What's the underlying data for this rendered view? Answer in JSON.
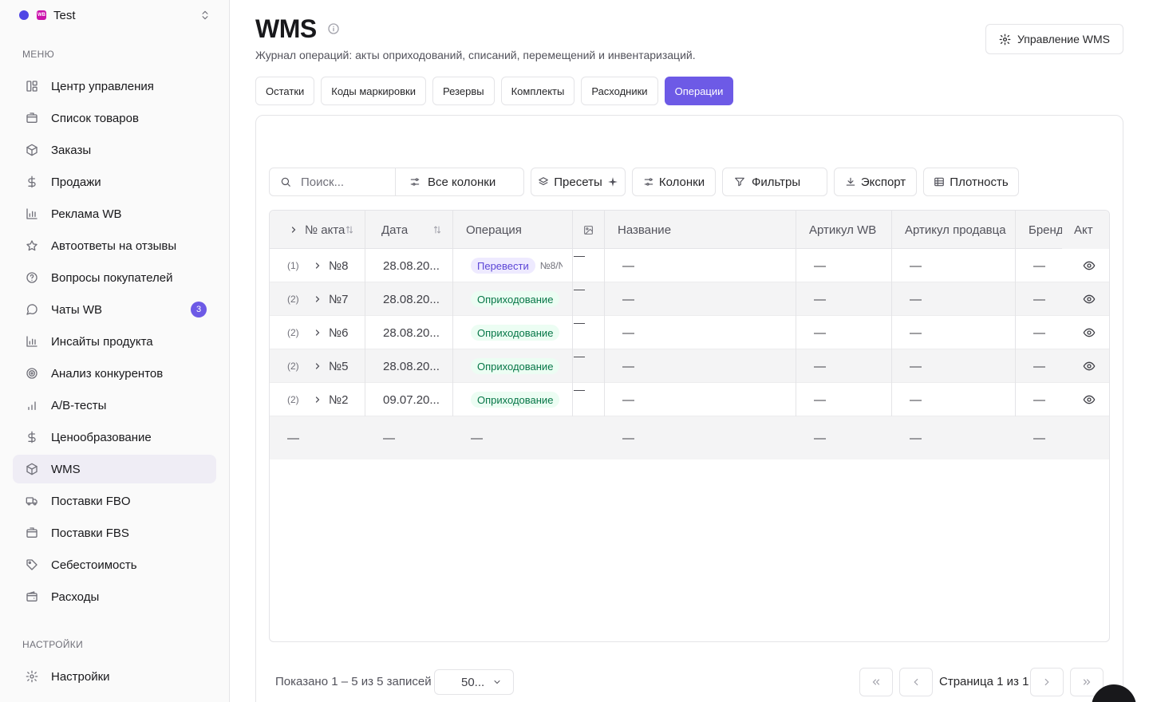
{
  "workspace": {
    "name": "Test",
    "logo_text": "WB"
  },
  "sidebar": {
    "menu_label": "МЕНЮ",
    "settings_label": "НАСТРОЙКИ",
    "items": [
      {
        "label": "Центр управления",
        "icon": "dashboard-icon"
      },
      {
        "label": "Список товаров",
        "icon": "box-icon"
      },
      {
        "label": "Заказы",
        "icon": "package-icon"
      },
      {
        "label": "Продажи",
        "icon": "dollar-icon"
      },
      {
        "label": "Реклама WB",
        "icon": "bar-chart-icon"
      },
      {
        "label": "Автоответы на отзывы",
        "icon": "star-icon"
      },
      {
        "label": "Вопросы покупателей",
        "icon": "help-circle-icon"
      },
      {
        "label": "Чаты WB",
        "icon": "chat-icon",
        "badge": "3"
      },
      {
        "label": "Инсайты продукта",
        "icon": "bar-chart-icon"
      },
      {
        "label": "Анализ конкурентов",
        "icon": "target-icon"
      },
      {
        "label": "A/B-тесты",
        "icon": "signal-icon"
      },
      {
        "label": "Ценообразование",
        "icon": "dollar-icon"
      },
      {
        "label": "WMS",
        "icon": "package-icon",
        "active": true
      },
      {
        "label": "Поставки FBO",
        "icon": "truck-icon"
      },
      {
        "label": "Поставки FBS",
        "icon": "box-icon"
      },
      {
        "label": "Себестоимость",
        "icon": "tag-icon"
      },
      {
        "label": "Расходы",
        "icon": "wallet-icon"
      }
    ],
    "settings_item": {
      "label": "Настройки",
      "icon": "gear-icon"
    }
  },
  "header": {
    "title": "WMS",
    "subtitle": "Журнал операций: акты оприходований, списаний, перемещений и инвентаризаций.",
    "manage_button": "Управление WMS"
  },
  "tabs": [
    {
      "label": "Остатки"
    },
    {
      "label": "Коды маркировки"
    },
    {
      "label": "Резервы"
    },
    {
      "label": "Комплекты"
    },
    {
      "label": "Расходники"
    },
    {
      "label": "Операции",
      "active": true
    }
  ],
  "toolbar": {
    "search_placeholder": "Поиск...",
    "all_columns": "Все колонки",
    "presets": "Пресеты",
    "columns": "Колонки",
    "filters": "Фильтры",
    "export": "Экспорт",
    "density": "Плотность"
  },
  "table": {
    "columns": {
      "act": "№ акта",
      "date": "Дата",
      "operation": "Операция",
      "name": "Название",
      "article_wb": "Артикул WB",
      "article_seller": "Артикул продавца",
      "brand": "Бренд",
      "akt": "Акт"
    },
    "rows": [
      {
        "count": "(1)",
        "act": "№8",
        "date": "28.08.20...",
        "operation": "Перевести",
        "op_type": "move",
        "op_ref": "№8/N",
        "name": "—",
        "article_wb": "—",
        "article_seller": "—",
        "brand": "—"
      },
      {
        "count": "(2)",
        "act": "№7",
        "date": "28.08.20...",
        "operation": "Оприходование",
        "op_type": "in",
        "op_ref": "",
        "name": "—",
        "article_wb": "—",
        "article_seller": "—",
        "brand": "—"
      },
      {
        "count": "(2)",
        "act": "№6",
        "date": "28.08.20...",
        "operation": "Оприходование",
        "op_type": "in",
        "op_ref": "",
        "name": "—",
        "article_wb": "—",
        "article_seller": "—",
        "brand": "—"
      },
      {
        "count": "(2)",
        "act": "№5",
        "date": "28.08.20...",
        "operation": "Оприходование",
        "op_type": "in",
        "op_ref": "",
        "name": "—",
        "article_wb": "—",
        "article_seller": "—",
        "brand": "—"
      },
      {
        "count": "(2)",
        "act": "№2",
        "date": "09.07.20...",
        "operation": "Оприходование",
        "op_type": "in",
        "op_ref": "",
        "name": "—",
        "article_wb": "—",
        "article_seller": "—",
        "brand": "—"
      }
    ],
    "footer": [
      "—",
      "—",
      "—",
      "—",
      "—",
      "—",
      "—"
    ],
    "image_dash": "—"
  },
  "pagination": {
    "shown_text": "Показано 1 – 5 из 5 записей",
    "page_size": "50...",
    "page_text": "Страница 1 из 1"
  },
  "colors": {
    "accent": "#6d5ae6",
    "move_badge_bg": "#eeeaff",
    "in_badge_bg": "#ecfdf3",
    "in_badge_text": "#067647"
  }
}
